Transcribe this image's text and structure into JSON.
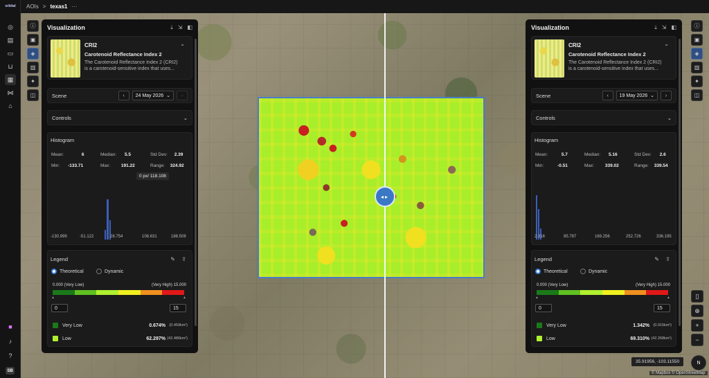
{
  "breadcrumb": {
    "root": "AOIs",
    "sep": ">",
    "current": "texas1",
    "more": "···"
  },
  "user": {
    "initials": "SB"
  },
  "app": {
    "logo": "orbital"
  },
  "colors": {
    "accent": "#3a78c6",
    "panel_bg": "#111111",
    "colorbar": [
      "#1a7a1a",
      "#60c020",
      "#b0f030",
      "#f0f020",
      "#f09020",
      "#e01818"
    ]
  },
  "left_panel": {
    "title": "Visualization",
    "layer": {
      "short": "CRI2",
      "name": "Carotenoid Reflectance Index 2",
      "description": "The Carotenoid Reflectance Index 2 (CRI2) is a carotenoid-sensitive index that uses..."
    },
    "scene": {
      "label": "Scene",
      "date": "24 May 2026"
    },
    "controls": {
      "label": "Controls"
    },
    "histogram": {
      "title": "Histogram",
      "mean_label": "Mean:",
      "mean": "6",
      "median_label": "Median:",
      "median": "5.5",
      "std_label": "Std Dev:",
      "std": "2.39",
      "min_label": "Min:",
      "min": "-133.71",
      "max_label": "Max:",
      "max": "191.22",
      "range_label": "Range:",
      "range": "324.92",
      "tooltip": "0 px/ 118.108",
      "ticks": [
        "-130.999",
        "-51.122",
        "28.754",
        "108.631",
        "188.508"
      ]
    },
    "legend": {
      "title": "Legend",
      "mode_theoretical": "Theoretical",
      "mode_dynamic": "Dynamic",
      "low_label": "0.000 (Very Low)",
      "high_label": "(Very High) 15.000",
      "min_value": "0",
      "max_value": "15",
      "classes": [
        {
          "name": "Very Low",
          "pct": "0.674%",
          "area": "(0.459km²)",
          "color": "#1a7a1a"
        },
        {
          "name": "Low",
          "pct": "62.297%",
          "area": "(42.486km²)",
          "color": "#b0f030"
        }
      ]
    }
  },
  "right_panel": {
    "title": "Visualization",
    "layer": {
      "short": "CRI2",
      "name": "Carotenoid Reflectance Index 2",
      "description": "The Carotenoid Reflectance Index 2 (CRI2) is a carotenoid-sensitive index that uses..."
    },
    "scene": {
      "label": "Scene",
      "date": "19 May 2026"
    },
    "controls": {
      "label": "Controls"
    },
    "histogram": {
      "title": "Histogram",
      "mean_label": "Mean:",
      "mean": "5.7",
      "median_label": "Median:",
      "median": "5.16",
      "std_label": "Std Dev:",
      "std": "2.6",
      "min_label": "Min:",
      "min": "-0.51",
      "max_label": "Max:",
      "max": "339.02",
      "range_label": "Range:",
      "range": "339.54",
      "ticks": [
        "2.316",
        "85.787",
        "169.256",
        "252.726",
        "336.195"
      ]
    },
    "legend": {
      "title": "Legend",
      "mode_theoretical": "Theoretical",
      "mode_dynamic": "Dynamic",
      "low_label": "0.000 (Very Low)",
      "high_label": "(Very High) 15.000",
      "min_value": "0",
      "max_value": "15",
      "classes": [
        {
          "name": "Very Low",
          "pct": "1.342%",
          "area": "(0.915km²)",
          "color": "#1a7a1a"
        },
        {
          "name": "Low",
          "pct": "69.310%",
          "area": "(42.268km²)",
          "color": "#b0f030"
        }
      ]
    }
  },
  "map": {
    "coords": "35.91956, -103.11550",
    "attribution": "© Mapbox © OpenStreetMap",
    "compass": "N",
    "zoom_in": "+",
    "zoom_out": "−"
  }
}
